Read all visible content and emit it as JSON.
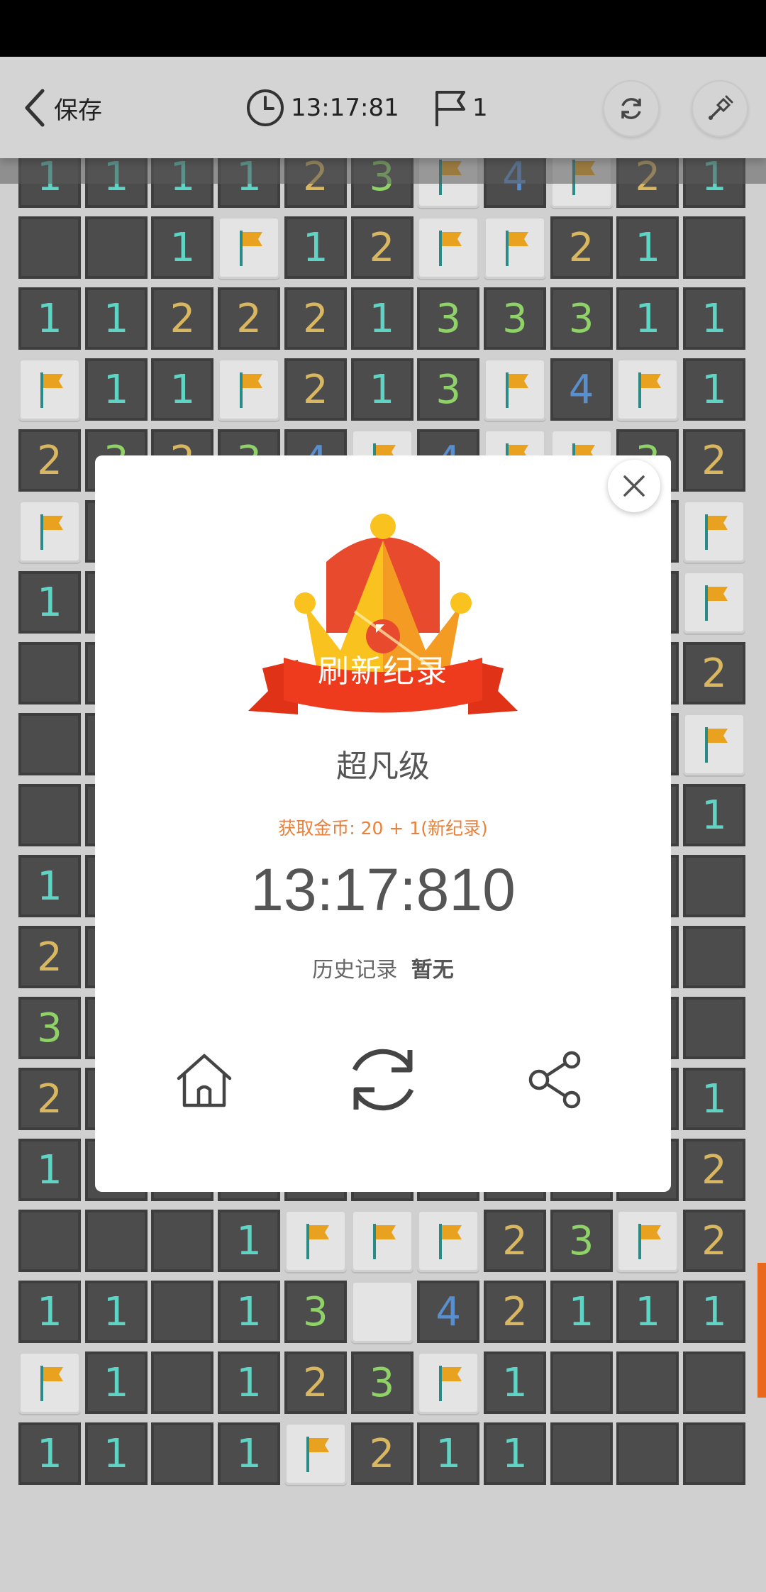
{
  "topbar": {
    "back_label": "保存",
    "timer": "13:17:81",
    "flag_count": "1"
  },
  "board": {
    "rows": [
      [
        "1",
        "1",
        "1",
        "1",
        "2",
        "3",
        "F",
        "4",
        "F",
        "2",
        "1"
      ],
      [
        "",
        "",
        "1",
        "F",
        "1",
        "2",
        "F",
        "F",
        "2",
        "1",
        ""
      ],
      [
        "1",
        "1",
        "2",
        "2",
        "2",
        "1",
        "3",
        "3",
        "3",
        "1",
        "1"
      ],
      [
        "F",
        "1",
        "1",
        "F",
        "2",
        "1",
        "3",
        "F",
        "4",
        "F",
        "1"
      ],
      [
        "2",
        "3",
        "2",
        "3",
        "4",
        "F",
        "4",
        "F",
        "F",
        "3",
        "2"
      ],
      [
        "F",
        "",
        "",
        "",
        "",
        "",
        "",
        "",
        "",
        "",
        "F"
      ],
      [
        "1",
        "",
        "",
        "",
        "",
        "",
        "",
        "",
        "",
        "",
        "F"
      ],
      [
        "",
        "",
        "",
        "",
        "",
        "",
        "",
        "",
        "",
        "",
        "2"
      ],
      [
        "",
        "",
        "",
        "",
        "",
        "",
        "",
        "",
        "",
        "",
        "F"
      ],
      [
        "",
        "",
        "",
        "",
        "",
        "",
        "",
        "",
        "",
        "",
        "1"
      ],
      [
        "1",
        "",
        "",
        "",
        "",
        "",
        "",
        "",
        "",
        "",
        ""
      ],
      [
        "2",
        "",
        "",
        "",
        "",
        "",
        "",
        "",
        "",
        "",
        ""
      ],
      [
        "3",
        "",
        "",
        "",
        "",
        "",
        "",
        "",
        "",
        "",
        ""
      ],
      [
        "2",
        "",
        "",
        "",
        "",
        "",
        "",
        "",
        "",
        "",
        "1"
      ],
      [
        "1",
        "",
        "",
        "",
        "",
        "",
        "",
        "",
        "",
        "",
        "2"
      ],
      [
        "",
        "",
        "",
        "1",
        "F",
        "F",
        "F",
        "2",
        "3",
        "F",
        "2"
      ],
      [
        "1",
        "1",
        "",
        "1",
        "3",
        "C",
        "4",
        "2",
        "1",
        "1",
        "1"
      ],
      [
        "F",
        "1",
        "",
        "1",
        "2",
        "3",
        "F",
        "1",
        "",
        "",
        ""
      ],
      [
        "1",
        "1",
        "",
        "1",
        "F",
        "2",
        "1",
        "1",
        "",
        "",
        ""
      ]
    ]
  },
  "modal": {
    "banner": "刷新纪录",
    "level": "超凡级",
    "coins": "获取金币: 20 + 1(新纪录)",
    "time": "13:17:810",
    "history_label": "历史记录",
    "history_value": "暂无"
  },
  "colors": {
    "accent_orange": "#e8813b",
    "banner_red": "#e83a1c",
    "number_1": "#5fd4c4",
    "number_2": "#d9b760",
    "number_3": "#8fd268",
    "number_4": "#5a8fcf",
    "flag": "#e9a21f"
  }
}
